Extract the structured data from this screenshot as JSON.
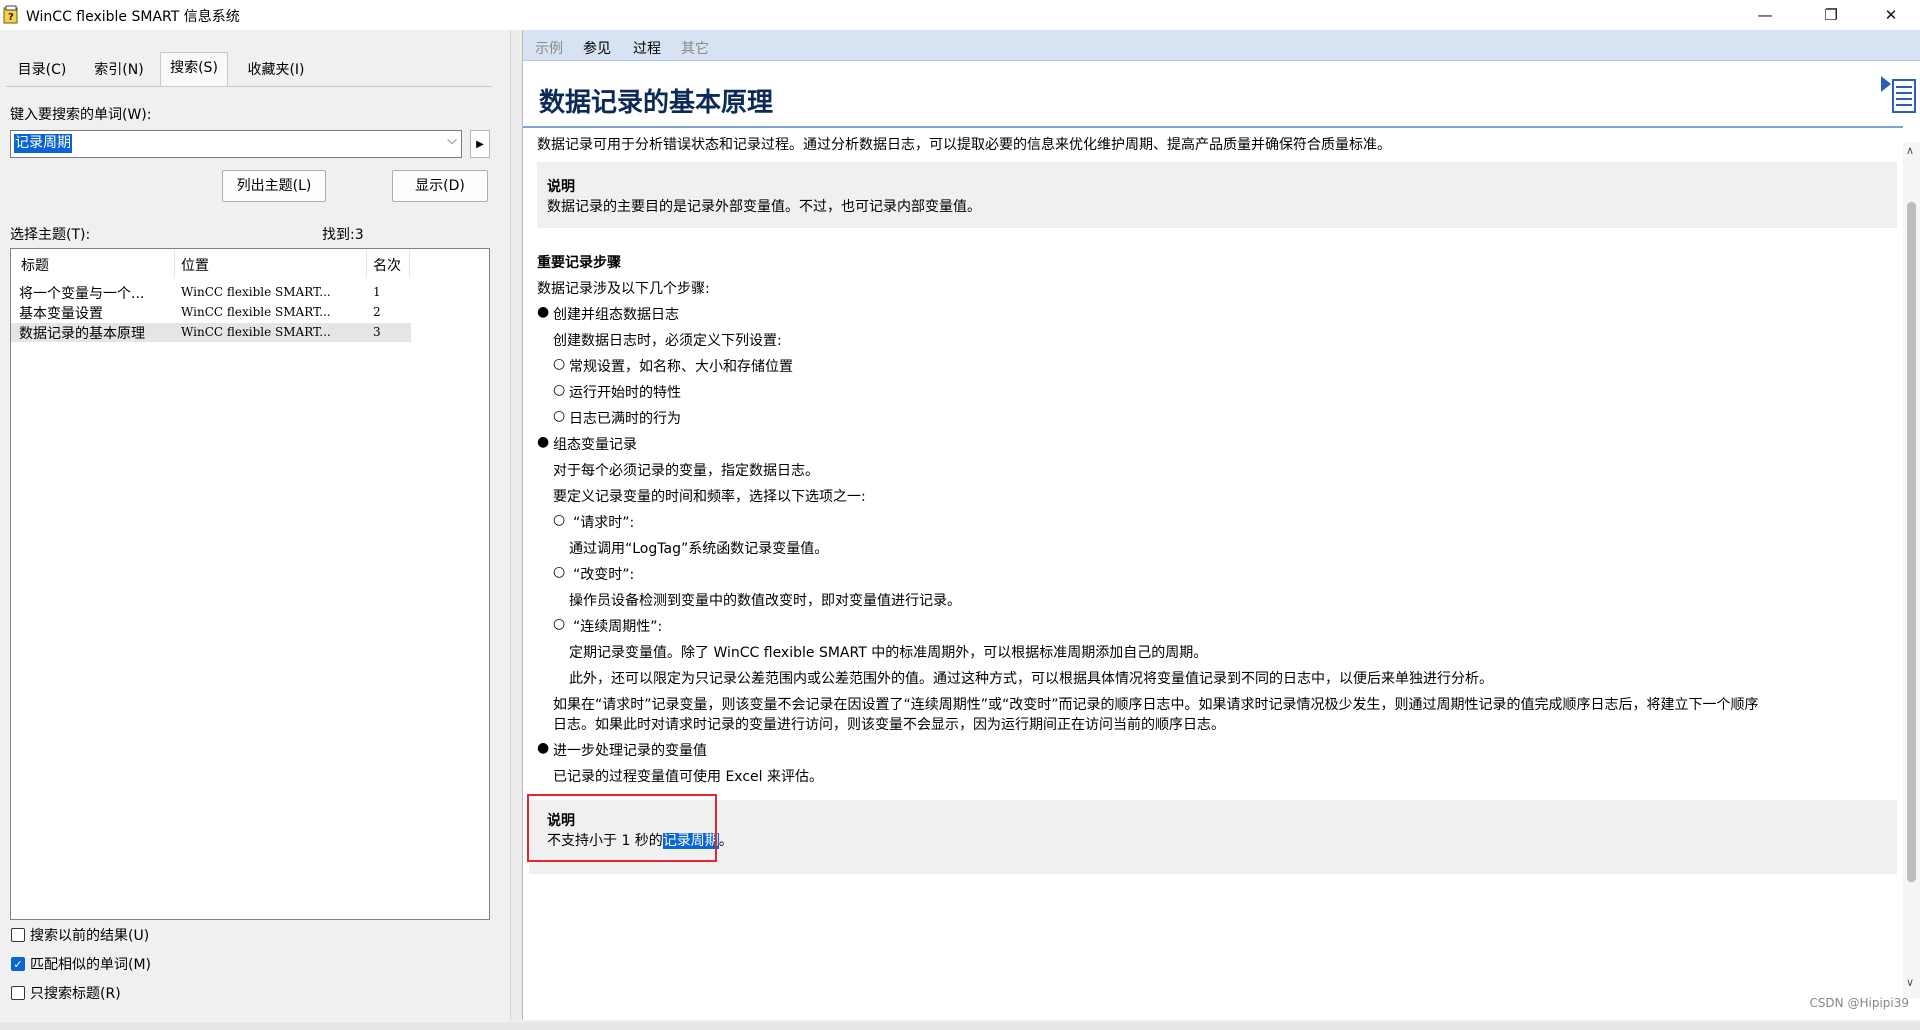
{
  "window": {
    "title": "WinCC flexible SMART 信息系统",
    "controls": {
      "minimize": "—",
      "restore": "❐",
      "close": "✕"
    }
  },
  "left": {
    "tabs": [
      "目录(C)",
      "索引(N)",
      "搜索(S)",
      "收藏夹(I)"
    ],
    "active_tab": "搜索(S)",
    "search_label": "键入要搜索的单词(W):",
    "search_value": "记录周期",
    "list_topics_button": "列出主题(L)",
    "display_button": "显示(D)",
    "select_topic_label": "选择主题(T):",
    "found_label": "找到:3",
    "columns": [
      "标题",
      "位置",
      "名次"
    ],
    "rows": [
      {
        "title": "将一个变量与一个...",
        "location": "WinCC flexible SMART...",
        "rank": "1"
      },
      {
        "title": "基本变量设置",
        "location": "WinCC flexible SMART...",
        "rank": "2"
      },
      {
        "title": "数据记录的基本原理",
        "location": "WinCC flexible SMART...",
        "rank": "3"
      }
    ],
    "checkboxes": [
      {
        "label": "搜索以前的结果(U)",
        "checked": false
      },
      {
        "label": "匹配相似的单词(M)",
        "checked": true
      },
      {
        "label": "只搜索标题(R)",
        "checked": false
      }
    ]
  },
  "right": {
    "nav": [
      "示例",
      "参见",
      "过程",
      "其它"
    ],
    "title": "数据记录的基本原理",
    "intro": "数据记录可用于分析错误状态和记录过程。通过分析数据日志，可以提取必要的信息来优化维护周期、提高产品质量并确保符合质量标准。",
    "note1_heading": "说明",
    "note1_text": "数据记录的主要目的是记录外部变量值。不过，也可记录内部变量值。",
    "steps_heading": "重要记录步骤",
    "steps_intro": "数据记录涉及以下几个步骤:",
    "step1": "创建并组态数据日志",
    "step1_text": "创建数据日志时，必须定义下列设置:",
    "step1_items": [
      "常规设置，如名称、大小和存储位置",
      "运行开始时的特性",
      "日志已满时的行为"
    ],
    "step2": "组态变量记录",
    "step2_text1": "对于每个必须记录的变量，指定数据日志。",
    "step2_text2": "要定义记录变量的时间和频率，选择以下选项之一:",
    "opt1": "“请求时”:",
    "opt1_text": "通过调用“LogTag”系统函数记录变量值。",
    "opt2": "“改变时”:",
    "opt2_text": "操作员设备检测到变量中的数值改变时，即对变量值进行记录。",
    "opt3": "“连续周期性”:",
    "opt3_text1": "定期记录变量值。除了 WinCC flexible SMART 中的标准周期外，可以根据标准周期添加自己的周期。",
    "opt3_text2": "此外，还可以限定为只记录公差范围内或公差范围外的值。通过这种方式，可以根据具体情况将变量值记录到不同的日志中，以便后来单独进行分析。",
    "para_line1": "如果在“请求时”记录变量，则该变量不会记录在因设置了“连续周期性”或“改变时”而记录的顺序日志中。如果请求时记录情况极少发生，则通过周期性记录的值完成顺序日志后，将建立下一个顺序",
    "para_line2": "日志。如果此时对请求时记录的变量进行访问，则该变量不会显示，因为运行期间正在访问当前的顺序日志。",
    "step3": "进一步处理记录的变量值",
    "step3_text": "已记录的过程变量值可使用 Excel 来评估。",
    "note2_heading": "说明",
    "note2_prefix": "不支持小于 1 秒的",
    "note2_highlight": "记录周期",
    "note2_suffix": "。"
  },
  "watermark": "CSDN @Hipipi39",
  "colors": {
    "accent": "#0a64d6",
    "title": "#0b2a55",
    "highlight_box": "#e0282e"
  }
}
